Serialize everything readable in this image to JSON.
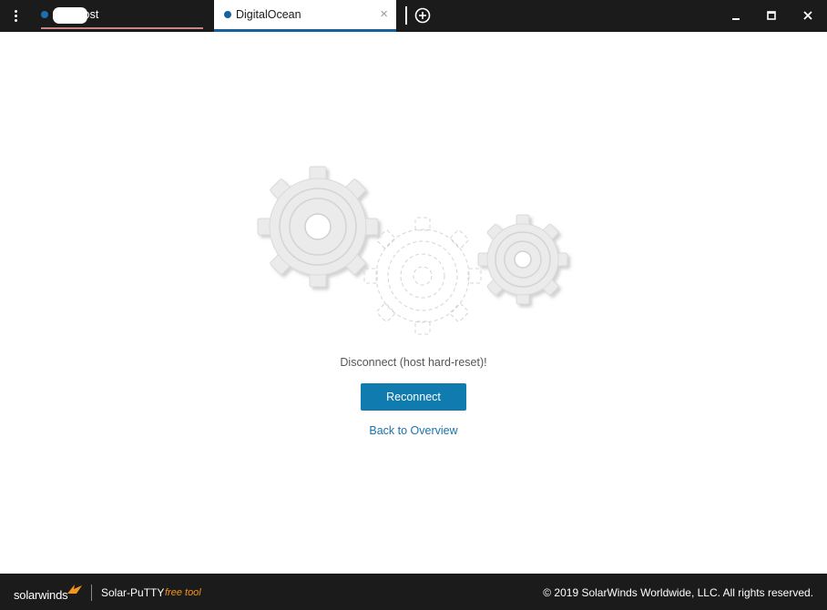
{
  "window": {
    "menu_icon": "kebab-menu-icon",
    "tabs": [
      {
        "label": "localhost",
        "active": false,
        "status_color": "#1f6fb0"
      },
      {
        "label": "DigitalOcean - ...",
        "active": true,
        "status_color": "#16629f",
        "close_label": "×"
      }
    ],
    "add_tab_icon": "plus-circle-icon",
    "controls": {
      "minimize_icon": "minimize-icon",
      "maximize_icon": "maximize-icon",
      "close_icon": "close-icon"
    }
  },
  "main": {
    "illustration_icon": "gears-icon",
    "message": "Disconnect (host hard-reset)!",
    "reconnect_label": "Reconnect",
    "back_label": "Back to Overview",
    "accent_color": "#0f7bae"
  },
  "footer": {
    "brand": "solarwinds",
    "product": "Solar-PuTTY",
    "free_tool": "free tool",
    "copyright": "© 2019 SolarWinds Worldwide, LLC. All rights reserved.",
    "brand_accent": "#f7941d"
  }
}
